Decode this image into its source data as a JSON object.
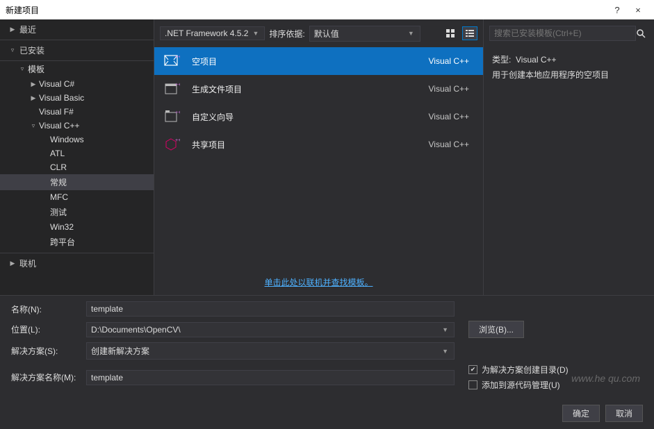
{
  "window": {
    "title": "新建项目",
    "help": "?",
    "close": "×"
  },
  "sidebar": {
    "recent": "最近",
    "installed": "已安装",
    "templates_label": "模板",
    "online": "联机",
    "lang": {
      "csharp": "Visual C#",
      "vb": "Visual Basic",
      "fsharp": "Visual F#",
      "vcpp": "Visual C++"
    },
    "vcpp_children": [
      "Windows",
      "ATL",
      "CLR",
      "常规",
      "MFC",
      "测试",
      "Win32",
      "跨平台"
    ]
  },
  "toolbar": {
    "framework": ".NET Framework 4.5.2",
    "sort_label": "排序依据:",
    "sort_value": "默认值"
  },
  "templates": [
    {
      "name": "空项目",
      "lang": "Visual C++",
      "selected": true
    },
    {
      "name": "生成文件项目",
      "lang": "Visual C++",
      "selected": false
    },
    {
      "name": "自定义向导",
      "lang": "Visual C++",
      "selected": false
    },
    {
      "name": "共享项目",
      "lang": "Visual C++",
      "selected": false
    }
  ],
  "online_link": "单击此处以联机并查找模板。",
  "search": {
    "placeholder": "搜索已安装模板(Ctrl+E)"
  },
  "detail": {
    "type_label": "类型:",
    "type_value": "Visual C++",
    "desc": "用于创建本地应用程序的空项目"
  },
  "form": {
    "name_label": "名称(N):",
    "name_value": "template",
    "location_label": "位置(L):",
    "location_value": "D:\\Documents\\OpenCV\\",
    "browse": "浏览(B)...",
    "solution_label": "解决方案(S):",
    "solution_value": "创建新解决方案",
    "solution_name_label": "解决方案名称(M):",
    "solution_name_value": "template",
    "check_create_dir": "为解决方案创建目录(D)",
    "check_source_control": "添加到源代码管理(U)"
  },
  "footer": {
    "ok": "确定",
    "cancel": "取消"
  },
  "watermark": "www.he qu.com"
}
